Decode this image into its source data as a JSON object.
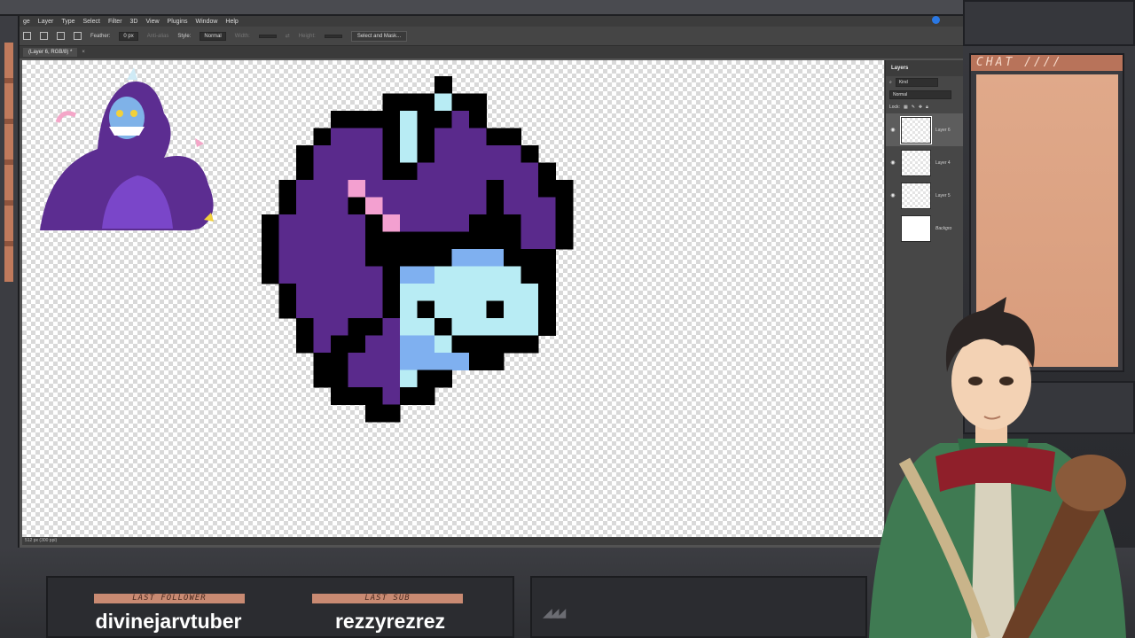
{
  "photoshop": {
    "menu": [
      "ge",
      "Layer",
      "Type",
      "Select",
      "Filter",
      "3D",
      "View",
      "Plugins",
      "Window",
      "Help"
    ],
    "options": {
      "feather_label": "Feather:",
      "feather_value": "0 px",
      "antialias": "Anti-alias",
      "style_label": "Style:",
      "style_value": "Normal",
      "width_label": "Width:",
      "height_label": "Height:",
      "select_mask_button": "Select and Mask..."
    },
    "doc_tab": "(Layer 6, RGB/8) *",
    "status": "512 px (300 ppi)",
    "layers_panel": {
      "title": "Layers",
      "filter": "Kind",
      "blend_mode": "Normal",
      "lock_label": "Lock:",
      "layers": [
        {
          "name": "Layer 6",
          "selected": true,
          "visible": true
        },
        {
          "name": "Layer 4",
          "selected": false,
          "visible": true
        },
        {
          "name": "Layer 5",
          "selected": false,
          "visible": true
        },
        {
          "name": "Backgro",
          "selected": false,
          "visible": false
        }
      ]
    }
  },
  "chat": {
    "title": "CHAT ////"
  },
  "overlay": {
    "last_follower_label": "LAST FOLLOWER",
    "last_follower_name": "divinejarvtuber",
    "last_sub_label": "LAST SUB",
    "last_sub_name": "rezzyrezrez"
  },
  "pixel_art": {
    "colors": {
      "K": "#000000",
      "P": "#5a2a8c",
      "L": "#b8ecf4",
      "B": "#7fb0f0",
      "k": "#f3a0d0"
    },
    "rows": [
      "..........K........",
      ".......KKKLKK......",
      "....KKKKLKKPK......",
      "...KPPPKLKPPPKK....",
      "..KPPPPKLKPPPPPK...",
      "..KPPPPKKPPPPPPPK..",
      ".KPPPkPPPPPPPKPPKK.",
      ".KPPPKkPPPPPPKPPPK.",
      "KPPPPPKkPPPPKKKPPK.",
      "KPPPPPKKKKKKKKKPPK.",
      "KPPPPPKKKKKBBBKKK..",
      "KPPPPPPKBBLLLLLKK..",
      ".KPPPPPKLLLLLLLLK..",
      ".KPPPPPKLKLLLKLLK..",
      "..KPPKKPLLKLLLLLK..",
      "..KPKKPPBBLKKKKK...",
      "...KKPPPBBBBKK.....",
      "...KKPPPLKK........",
      "....KKKPKK.........",
      "......KK..........."
    ]
  }
}
